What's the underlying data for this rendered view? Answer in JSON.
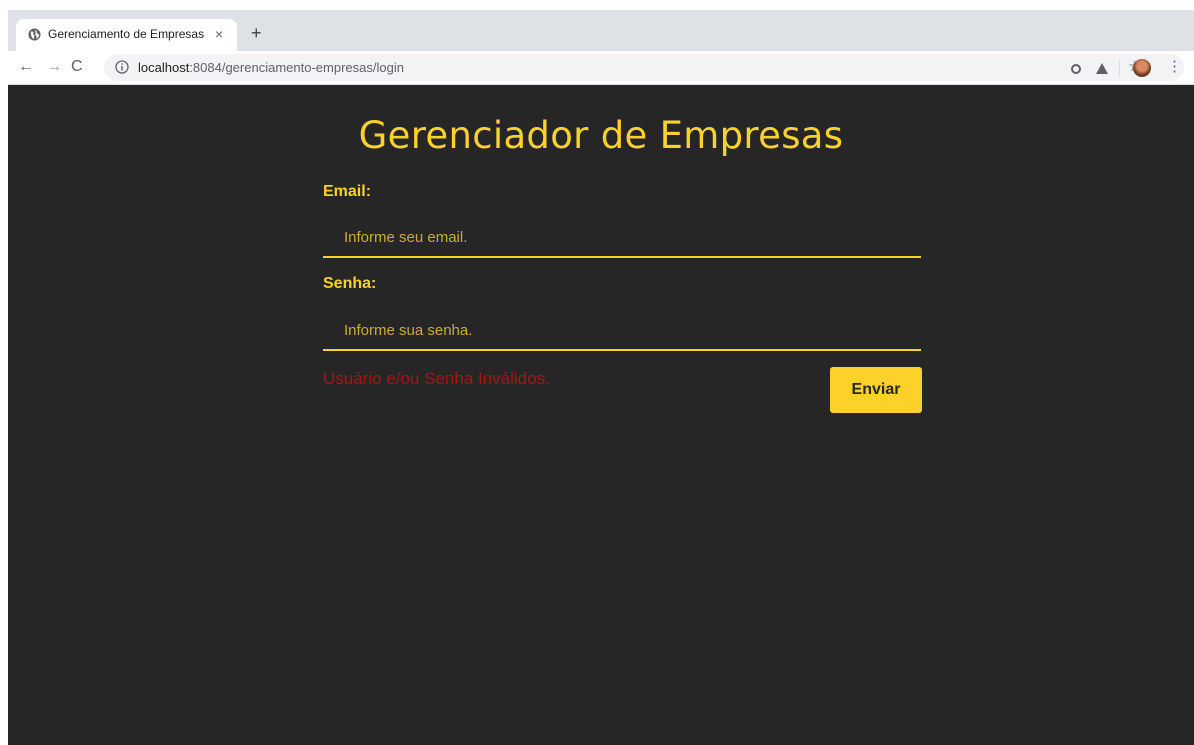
{
  "browser": {
    "tab": {
      "title": "Gerenciamento de Empresas",
      "close_glyph": "×",
      "favicon": "globe-icon"
    },
    "new_tab_glyph": "+",
    "toolbar": {
      "back_glyph": "←",
      "forward_glyph": "→",
      "reload_glyph": "C",
      "url_host": "localhost",
      "url_path": ":8084/gerenciamento-empresas/login",
      "star_glyph": "☆",
      "menu_glyph": "⋮"
    }
  },
  "page": {
    "title": "Gerenciador de Empresas",
    "email": {
      "label": "Email:",
      "placeholder": "Informe seu email.",
      "value": ""
    },
    "password": {
      "label": "Senha:",
      "placeholder": "Informe sua senha.",
      "value": ""
    },
    "error_message": "Usuário e/ou Senha Inválidos.",
    "submit_label": "Enviar"
  },
  "colors": {
    "page_background": "#262626",
    "accent": "#fcd12a",
    "error": "#a81414"
  }
}
